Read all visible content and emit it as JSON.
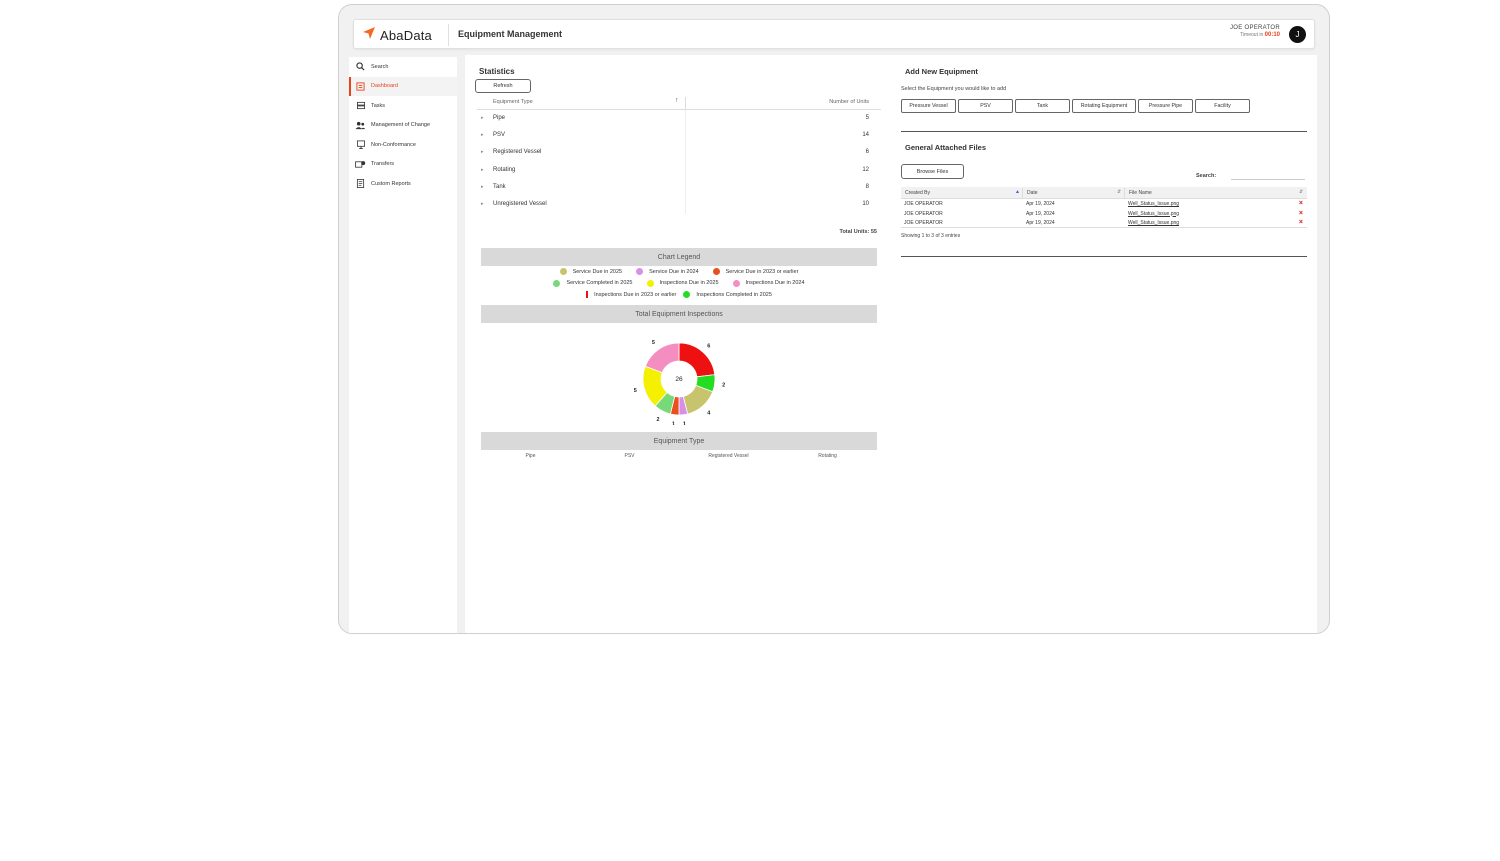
{
  "app": {
    "logo_text": "AbaData",
    "title": "Equipment Management"
  },
  "user": {
    "name": "JOE OPERATOR",
    "timeout_label": "Timeout in",
    "timeout_value": "00:10",
    "avatar_initial": "J"
  },
  "sidebar": {
    "items": [
      {
        "label": "Search",
        "icon": "search-icon",
        "active": false
      },
      {
        "label": "Dashboard",
        "icon": "dashboard-icon",
        "active": true
      },
      {
        "label": "Tasks",
        "icon": "tasks-icon",
        "active": false
      },
      {
        "label": "Management of Change",
        "icon": "people-icon",
        "active": false
      },
      {
        "label": "Non-Conformance",
        "icon": "alert-icon",
        "active": false
      },
      {
        "label": "Transfers",
        "icon": "transfer-icon",
        "active": false
      },
      {
        "label": "Custom Reports",
        "icon": "report-icon",
        "active": false
      }
    ]
  },
  "statistics": {
    "title": "Statistics",
    "refresh_label": "Refresh",
    "col_type": "Equipment Type",
    "col_units": "Number of Units",
    "rows": [
      {
        "type": "Pipe",
        "units": "5"
      },
      {
        "type": "PSV",
        "units": "14"
      },
      {
        "type": "Registered Vessel",
        "units": "6"
      },
      {
        "type": "Rotating",
        "units": "12"
      },
      {
        "type": "Tank",
        "units": "8"
      },
      {
        "type": "Unregistered Vessel",
        "units": "10"
      }
    ],
    "total": "Total Units: 55"
  },
  "legend": {
    "title": "Chart Legend",
    "items": [
      {
        "label": "Service Due in 2025",
        "color": "#c8c46e"
      },
      {
        "label": "Service Due in 2024",
        "color": "#d98ee8"
      },
      {
        "label": "Service Due in 2023 or earlier",
        "color": "#e8501c"
      },
      {
        "label": "Service Completed in 2025",
        "color": "#77d977"
      },
      {
        "label": "Inspections Due in 2025",
        "color": "#f4f000"
      },
      {
        "label": "Inspections Due in 2024",
        "color": "#f58ec0"
      },
      {
        "label": "Inspections Due in 2023 or earlier",
        "color": "#ee1111"
      },
      {
        "label": "Inspections Completed in 2025",
        "color": "#22dd22"
      }
    ]
  },
  "inspections": {
    "title": "Total Equipment Inspections",
    "center_total": "26"
  },
  "chart_data": {
    "type": "pie",
    "title": "Total Equipment Inspections",
    "donut": true,
    "center_label": "26",
    "series": [
      {
        "name": "Inspections Due in 2023 or earlier",
        "value": 6,
        "color": "#ee1111"
      },
      {
        "name": "Inspections Completed in 2025",
        "value": 2,
        "color": "#22dd22"
      },
      {
        "name": "Service Due in 2025",
        "value": 4,
        "color": "#c8c46e"
      },
      {
        "name": "Service Due in 2024",
        "value": 1,
        "color": "#d98ee8"
      },
      {
        "name": "Service Due in 2023 or earlier",
        "value": 1,
        "color": "#e8501c"
      },
      {
        "name": "Service Completed in 2025",
        "value": 2,
        "color": "#77d977"
      },
      {
        "name": "Inspections Due in 2025",
        "value": 5,
        "color": "#f4f000"
      },
      {
        "name": "Inspections Due in 2024",
        "value": 5,
        "color": "#f58ec0"
      }
    ]
  },
  "equipment_type_section": {
    "title": "Equipment Type",
    "labels": [
      "Pipe",
      "PSV",
      "Registered Vessel",
      "Rotating"
    ]
  },
  "add_equipment": {
    "title": "Add New Equipment",
    "subtitle": "Select the Equipment you would like to add",
    "buttons": [
      "Pressure Vessel",
      "PSV",
      "Tank",
      "Rotating Equipment",
      "Pressure Pipe",
      "Facility"
    ]
  },
  "files": {
    "title": "General Attached Files",
    "browse_label": "Browse Files",
    "search_label": "Search:",
    "search_value": "",
    "columns": [
      "Created By",
      "Date",
      "File Name"
    ],
    "rows": [
      {
        "created_by": "JOE OPERATOR",
        "date": "Apr 19, 2024",
        "file_name": "Well_Status_Issue.png"
      },
      {
        "created_by": "JOE OPERATOR",
        "date": "Apr 19, 2024",
        "file_name": "Well_Status_Issue.png"
      },
      {
        "created_by": "JOE OPERATOR",
        "date": "Apr 19, 2024",
        "file_name": "Well_Status_Issue.png"
      }
    ],
    "showing": "Showing 1 to 3 of 3 entries"
  }
}
